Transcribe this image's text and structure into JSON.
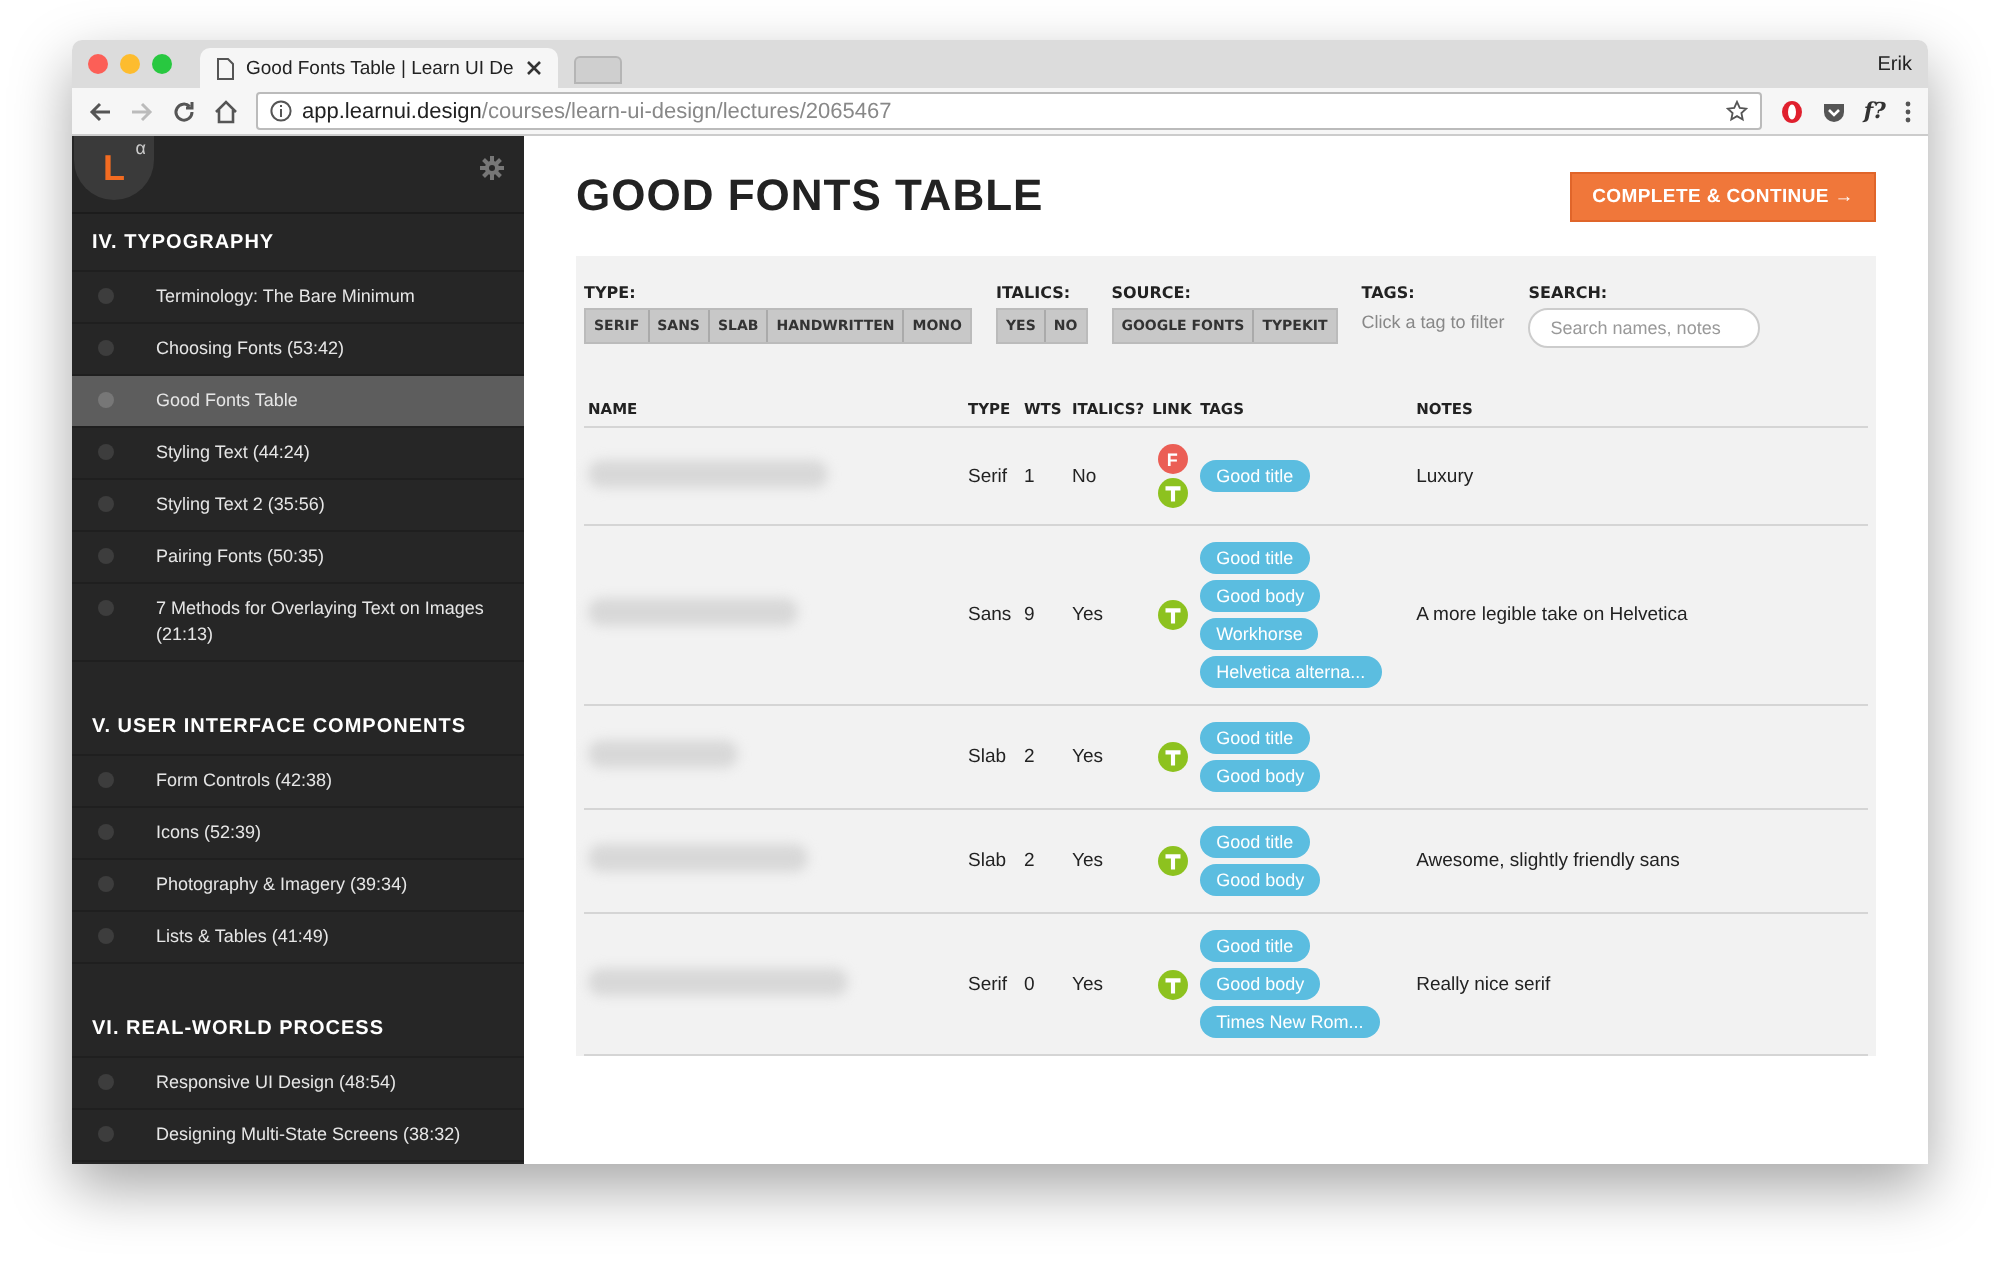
{
  "browser": {
    "tab_title": "Good Fonts Table | Learn UI De",
    "user": "Erik",
    "url_host": "app.learnui.design",
    "url_path": "/courses/learn-ui-design/lectures/2065467",
    "extension": "f?"
  },
  "logo": {
    "letter": "L",
    "mark": "α"
  },
  "sidebar": {
    "sections": [
      {
        "title": "IV. TYPOGRAPHY",
        "items": [
          {
            "label": "Terminology: The Bare Minimum",
            "selected": false
          },
          {
            "label": "Choosing Fonts (53:42)",
            "selected": false
          },
          {
            "label": "Good Fonts Table",
            "selected": true
          },
          {
            "label": "Styling Text (44:24)",
            "selected": false
          },
          {
            "label": "Styling Text 2 (35:56)",
            "selected": false
          },
          {
            "label": "Pairing Fonts (50:35)",
            "selected": false
          },
          {
            "label": "7 Methods for Overlaying Text on Images (21:13)",
            "selected": false
          }
        ]
      },
      {
        "title": "V. USER INTERFACE COMPONENTS",
        "items": [
          {
            "label": "Form Controls (42:38)",
            "selected": false
          },
          {
            "label": "Icons (52:39)",
            "selected": false
          },
          {
            "label": "Photography & Imagery (39:34)",
            "selected": false
          },
          {
            "label": "Lists & Tables (41:49)",
            "selected": false
          }
        ]
      },
      {
        "title": "VI. REAL-WORLD PROCESS",
        "items": [
          {
            "label": "Responsive UI Design (48:54)",
            "selected": false
          },
          {
            "label": "Designing Multi-State Screens (38:32)",
            "selected": false
          }
        ]
      }
    ]
  },
  "page": {
    "title": "GOOD FONTS TABLE",
    "action": "COMPLETE & CONTINUE →"
  },
  "filters": {
    "groups": [
      {
        "label": "TYPE:",
        "options": [
          {
            "label": "SERIF",
            "selected": false
          },
          {
            "label": "SANS",
            "selected": false
          },
          {
            "label": "SLAB",
            "selected": false
          },
          {
            "label": "HANDWRITTEN",
            "selected": false
          },
          {
            "label": "MONO",
            "selected": false
          }
        ]
      },
      {
        "label": "ITALICS:",
        "options": [
          {
            "label": "YES",
            "selected": false
          },
          {
            "label": "NO",
            "selected": false
          }
        ]
      },
      {
        "label": "SOURCE:",
        "options": [
          {
            "label": "GOOGLE FONTS",
            "selected": false
          },
          {
            "label": "TYPEKIT",
            "selected": false
          }
        ]
      }
    ],
    "tags": {
      "label": "TAGS:",
      "hint": "Click a tag to filter"
    },
    "search": {
      "label": "SEARCH:",
      "placeholder": "Search names, notes"
    }
  },
  "table": {
    "columns": [
      "NAME",
      "TYPE",
      "WTS",
      "ITALICS?",
      "LINK",
      "TAGS",
      "NOTES"
    ],
    "rows": [
      {
        "type": "Serif",
        "wts": "1",
        "italics": "No",
        "links": [
          {
            "kind": "google",
            "label": "F"
          },
          {
            "kind": "typekit"
          }
        ],
        "tags": [
          "Good title"
        ],
        "notes": "Luxury"
      },
      {
        "type": "Sans",
        "wts": "9",
        "italics": "Yes",
        "links": [
          {
            "kind": "typekit"
          }
        ],
        "tags": [
          "Good title",
          "Good body",
          "Workhorse",
          "Helvetica alterna..."
        ],
        "notes": "A more legible take on Helvetica"
      },
      {
        "type": "Slab",
        "wts": "2",
        "italics": "Yes",
        "links": [
          {
            "kind": "typekit"
          }
        ],
        "tags": [
          "Good title",
          "Good body"
        ]
      },
      {
        "type": "Slab",
        "wts": "2",
        "italics": "Yes",
        "links": [
          {
            "kind": "typekit"
          }
        ],
        "tags": [
          "Good title",
          "Good body"
        ],
        "notes": "Awesome, slightly friendly sans"
      },
      {
        "type": "Serif",
        "wts": "0",
        "italics": "Yes",
        "links": [
          {
            "kind": "typekit"
          }
        ],
        "tags": [
          "Good title",
          "Good body",
          "Times New Rom..."
        ],
        "notes": "Really nice serif"
      }
    ]
  }
}
